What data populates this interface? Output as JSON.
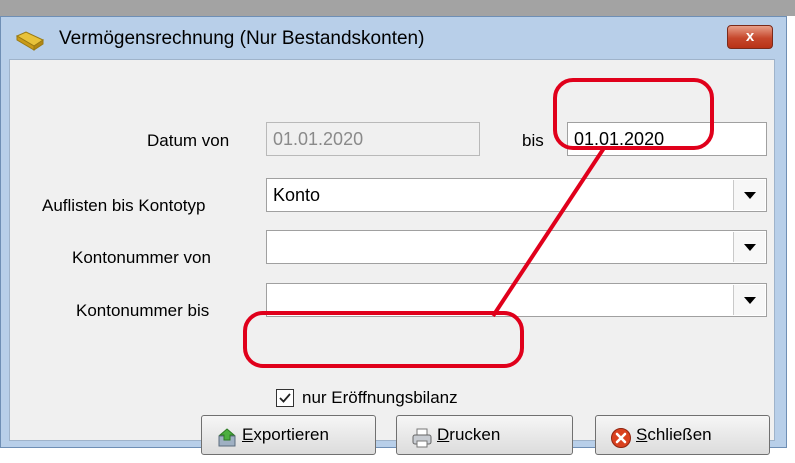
{
  "window": {
    "title": "Vermögensrechnung (Nur Bestandskonten)",
    "close_glyph": "x",
    "icon": "folder-coins-icon"
  },
  "form": {
    "datum_von_label": "Datum von",
    "datum_von_value": "01.01.2020",
    "bis_label": "bis",
    "bis_value": "01.01.2020",
    "kontotyp_label": "Auflisten bis Kontotyp",
    "kontotyp_value": "Konto",
    "kontonummer_von_label": "Kontonummer von",
    "kontonummer_von_value": "",
    "kontonummer_bis_label": "Kontonummer bis",
    "kontonummer_bis_value": "",
    "eroeffnung_label": "nur Eröffnungsbilanz",
    "eroeffnung_checked": true
  },
  "buttons": {
    "export_accel": "E",
    "export_rest": "xportieren",
    "print_accel": "D",
    "print_rest": "rucken",
    "close_accel": "S",
    "close_rest": "chließen"
  },
  "colors": {
    "annotation": "#e0001b",
    "titlebar": "#b8cfe9",
    "close_button": "#c6472c"
  }
}
